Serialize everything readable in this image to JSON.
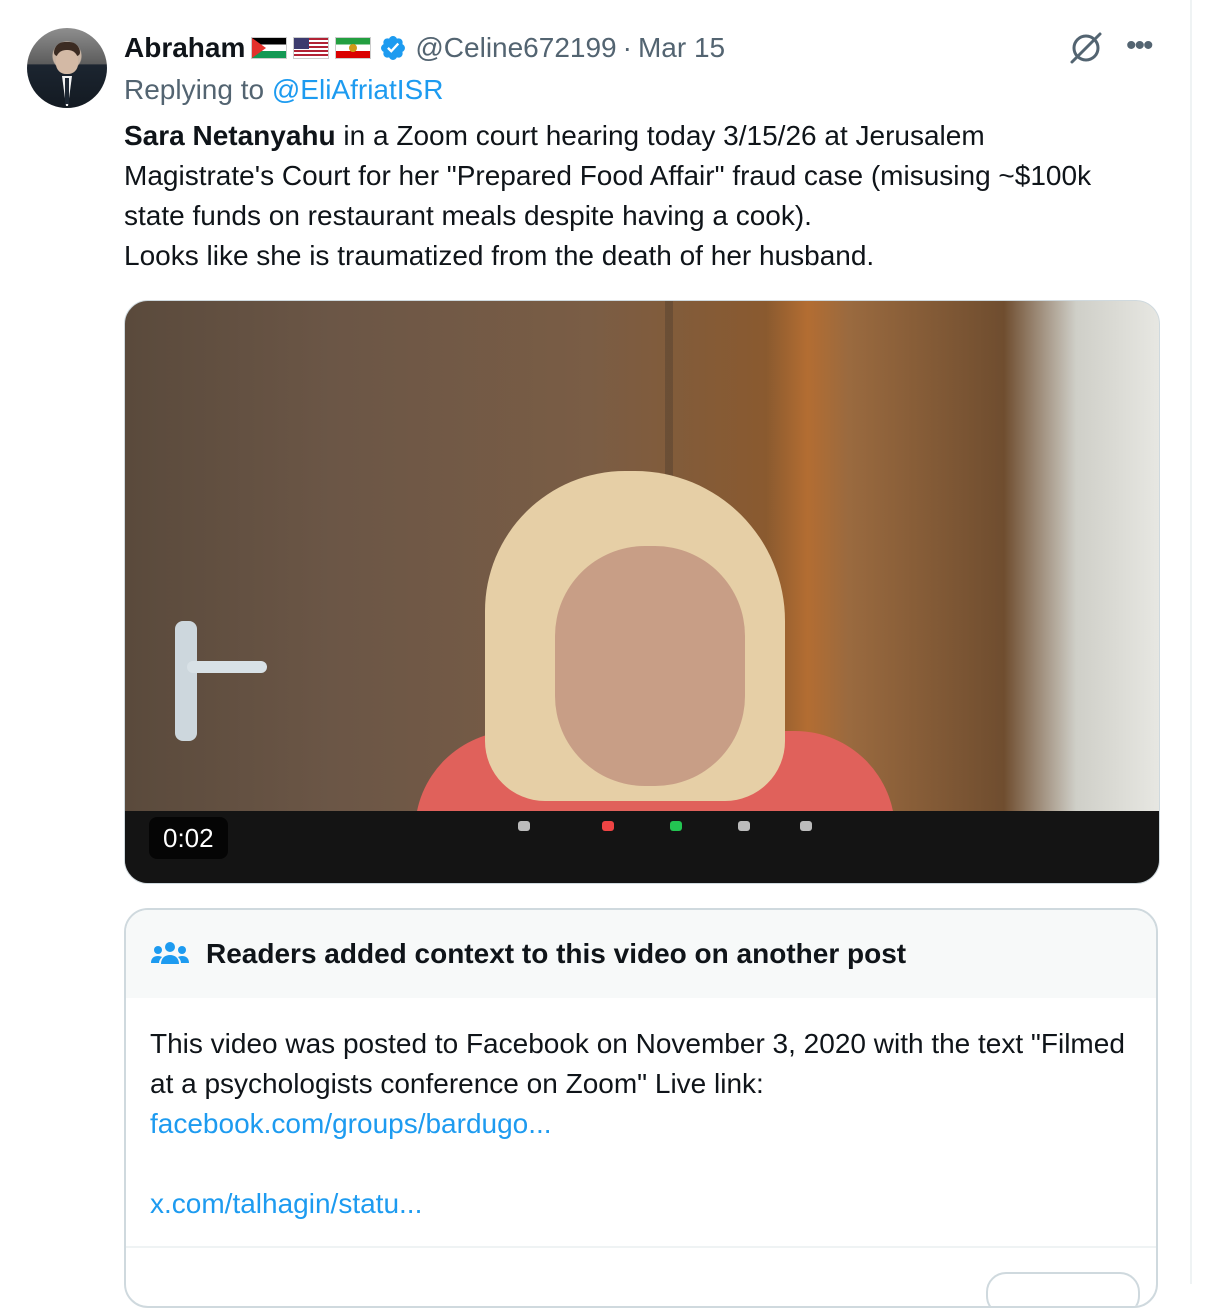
{
  "author": {
    "name": "Abraham",
    "flags": [
      "palestine-flag",
      "usa-flag",
      "iran-lion-sun-flag"
    ],
    "handle": "@Celine672199",
    "separator": "·",
    "date": "Mar 15"
  },
  "reply": {
    "prefix": "Replying to ",
    "target": "@EliAfriatISR"
  },
  "tweet": {
    "bold": "Sara Netanyahu",
    "text": " in a Zoom court hearing today 3/15/26 at Jerusalem Magistrate's Court for her \"Prepared Food Affair\" fraud case (misusing ~$100k state funds on restaurant meals despite having a cook).",
    "line2": "Looks like she is traumatized from the death of her husband."
  },
  "video": {
    "timestamp": "0:02"
  },
  "context_note": {
    "title": "Readers added context to this video on another post",
    "body": "This video was posted to Facebook on November 3, 2020 with the text \"Filmed at a psychologists conference on Zoom\" Live link:",
    "link1": "facebook.com/groups/bardugo...",
    "link2": "x.com/talhagin/statu..."
  },
  "colors": {
    "accent": "#1d9bf0",
    "muted": "#536471",
    "text": "#0f1419"
  }
}
